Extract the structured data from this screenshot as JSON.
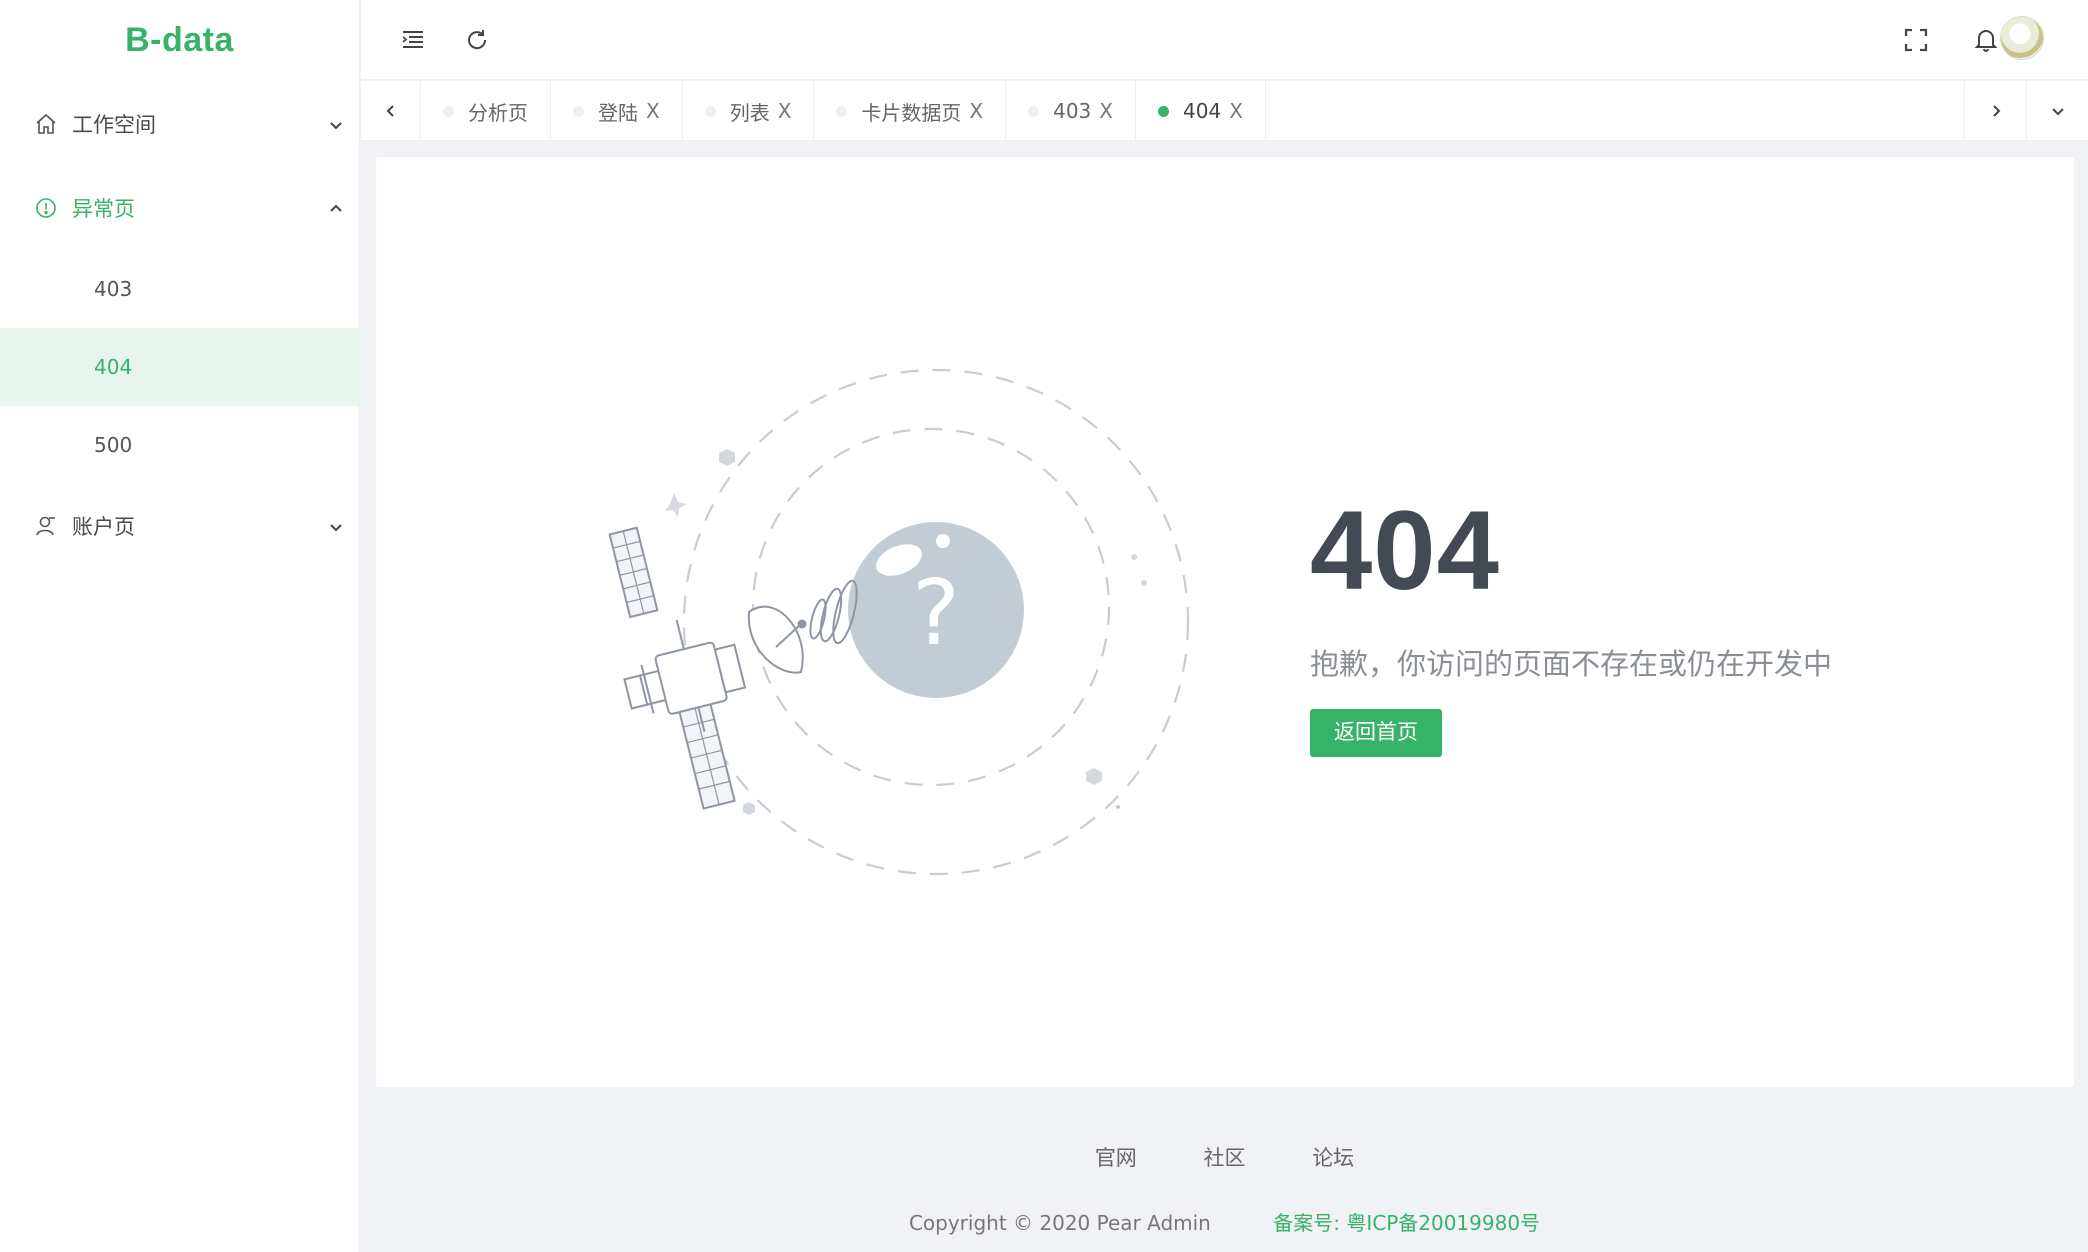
{
  "app": {
    "logo": "B-data"
  },
  "sidebar": {
    "items": [
      {
        "label": "工作空间",
        "icon": "home-icon",
        "open": false
      },
      {
        "label": "异常页",
        "icon": "alert-icon",
        "open": true,
        "children": [
          {
            "label": "403",
            "active": false
          },
          {
            "label": "404",
            "active": true
          },
          {
            "label": "500",
            "active": false
          }
        ]
      },
      {
        "label": "账户页",
        "icon": "user-icon",
        "open": false
      }
    ]
  },
  "header": {
    "icons": [
      "menu-fold-icon",
      "refresh-icon",
      "fullscreen-icon",
      "bell-icon",
      "avatar"
    ]
  },
  "tabs": [
    {
      "label": "分析页",
      "closable": false,
      "active": false
    },
    {
      "label": "登陆",
      "closable": true,
      "active": false
    },
    {
      "label": "列表",
      "closable": true,
      "active": false
    },
    {
      "label": "卡片数据页",
      "closable": true,
      "active": false
    },
    {
      "label": "403",
      "closable": true,
      "active": false
    },
    {
      "label": "404",
      "closable": true,
      "active": true
    }
  ],
  "tab_close_glyph": "X",
  "error": {
    "code": "404",
    "message": "抱歉，你访问的页面不存在或仍在开发中",
    "button": "返回首页",
    "illustration": "satellite-question-illustration"
  },
  "footer": {
    "links": [
      "官网",
      "社区",
      "论坛"
    ],
    "copyright": "Copyright © 2020 Pear Admin",
    "beian": "备案号: 粤ICP备20019980号"
  },
  "colors": {
    "accent": "#36b368",
    "active_bg": "#e8f5ec",
    "error_code": "#434a54"
  }
}
